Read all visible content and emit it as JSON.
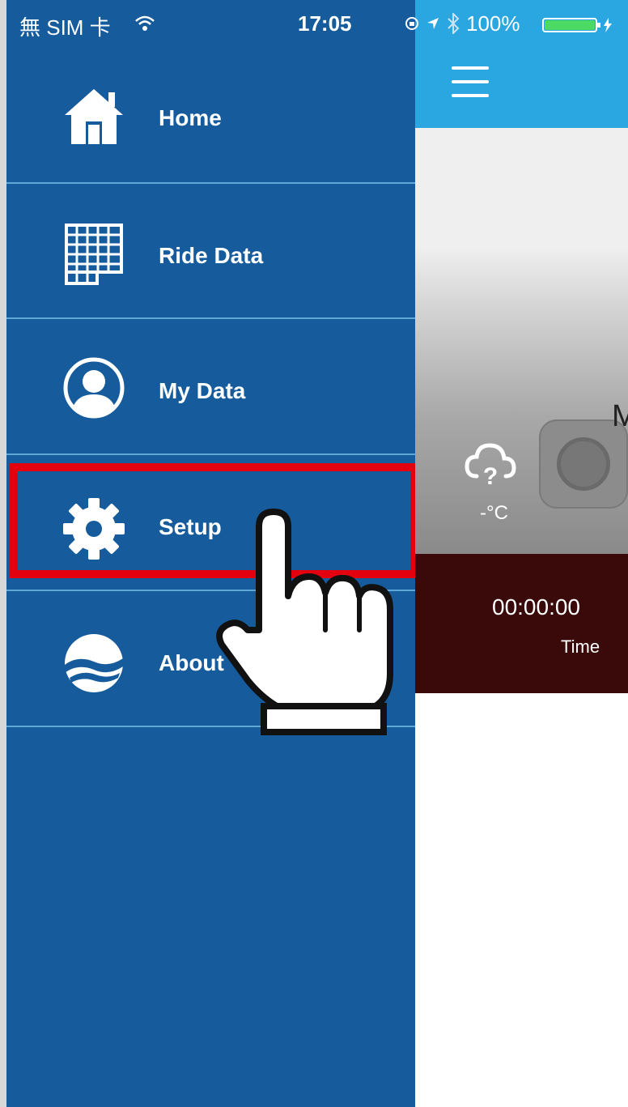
{
  "status_bar": {
    "carrier": "無 SIM 卡",
    "time": "17:05",
    "battery": "100%"
  },
  "drawer": {
    "items": [
      {
        "label": "Home",
        "icon": "home-icon"
      },
      {
        "label": "Ride Data",
        "icon": "grid-icon"
      },
      {
        "label": "My Data",
        "icon": "user-icon"
      },
      {
        "label": "Setup",
        "icon": "gear-icon"
      },
      {
        "label": "About",
        "icon": "wave-logo-icon"
      }
    ],
    "highlighted_item": "Setup"
  },
  "main": {
    "temperature": "-°C",
    "partial_title": "M",
    "time_value": "00:00:00",
    "time_label": "Time"
  },
  "colors": {
    "drawer_bg": "#165b9c",
    "header_bg": "#2aa6e1",
    "highlight": "#e3000f",
    "stats_bg": "#3a0a0a"
  }
}
